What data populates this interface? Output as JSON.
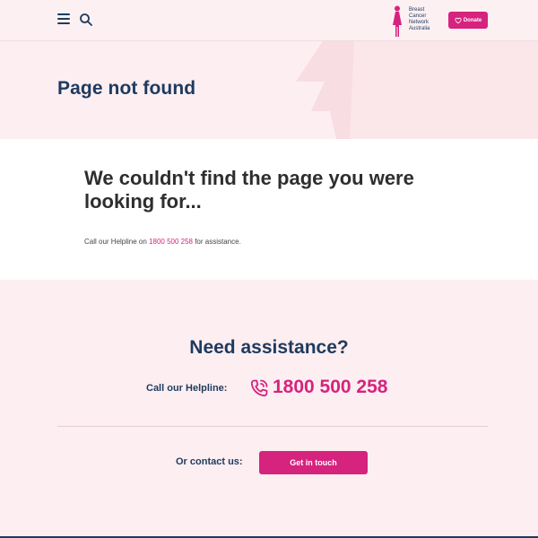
{
  "header": {
    "menu_icon": "hamburger-menu-icon",
    "search_icon": "search-icon",
    "logo": {
      "lines": [
        "Breast",
        "Cancer",
        "Network",
        "Australia"
      ]
    },
    "donate_label": "Donate"
  },
  "hero": {
    "title": "Page not found"
  },
  "content": {
    "heading": "We couldn't find the page you were looking for...",
    "note_prefix": "Call our Helpline on ",
    "note_number": "1800 500 258",
    "note_suffix": " for assistance."
  },
  "assist": {
    "title": "Need assistance?",
    "helpline_label": "Call our Helpline:",
    "helpline_number": "1800 500 258",
    "contact_label": "Or contact us:",
    "cta_label": "Get in touch"
  },
  "colors": {
    "brand_pink": "#d6237e",
    "navy": "#1e3a5f",
    "blush": "#fdeef1"
  }
}
